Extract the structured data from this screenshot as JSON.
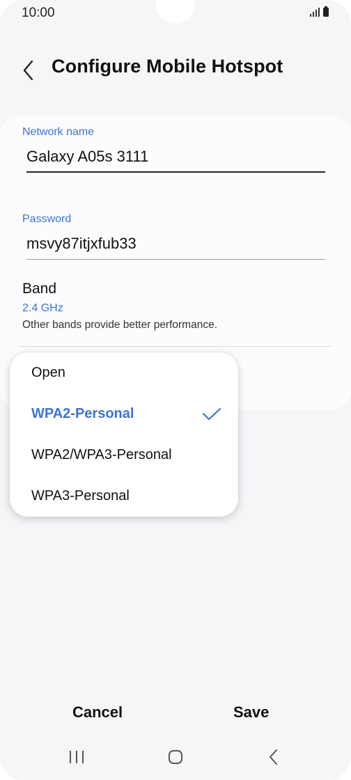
{
  "status_bar": {
    "time": "10:00"
  },
  "header": {
    "title": "Configure Mobile Hotspot",
    "back_icon": "chevron-left-icon"
  },
  "form": {
    "network_name": {
      "label": "Network name",
      "value": "Galaxy A05s 3111"
    },
    "password": {
      "label": "Password",
      "value": "msvy87itjxfub33"
    },
    "band": {
      "title": "Band",
      "value": "2.4 GHz",
      "description": "Other bands provide better performance."
    }
  },
  "security_dropdown": {
    "options": [
      {
        "label": "Open",
        "selected": false
      },
      {
        "label": "WPA2-Personal",
        "selected": true
      },
      {
        "label": "WPA2/WPA3-Personal",
        "selected": false
      },
      {
        "label": "WPA3-Personal",
        "selected": false
      }
    ]
  },
  "actions": {
    "cancel_label": "Cancel",
    "save_label": "Save"
  },
  "nav_bar": {
    "icons": [
      "recent-apps-icon",
      "home-icon",
      "back-icon"
    ]
  },
  "colors": {
    "accent": "#3e73d0",
    "background": "#f6f6f9",
    "card": "#fcfcfe"
  }
}
